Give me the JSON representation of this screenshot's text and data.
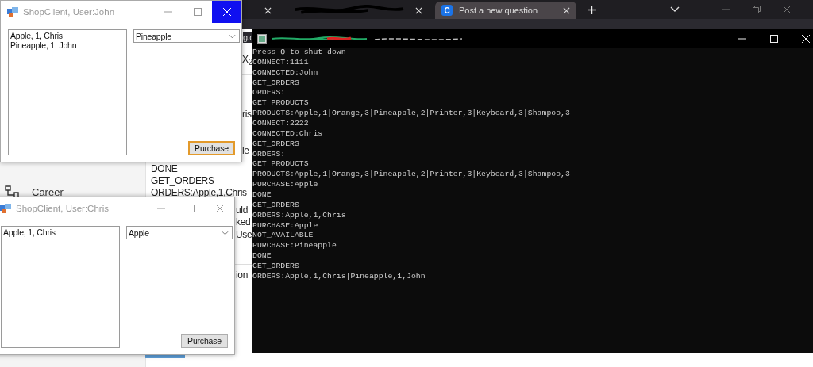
{
  "browser": {
    "tabs": [
      {
        "kind": "clipped",
        "selected": false
      },
      {
        "kind": "redacted",
        "selected": false
      },
      {
        "kind": "titled",
        "favicon_letter": "C",
        "label": "Post a new question",
        "selected": true
      }
    ],
    "address_fragment": "g.c"
  },
  "web_page": {
    "sidebar_item": "Career",
    "fragments": [
      "X$_{2}$",
      "ris",
      "le",
      "DONE",
      "GET_ORDERS",
      "ORDERS:Apple,1,Chris",
      "uld",
      "ked",
      "Use",
      "ion"
    ]
  },
  "console": {
    "lines": [
      "Press Q to shut down",
      "CONNECT:1111",
      "CONNECTED:John",
      "GET_ORDERS",
      "ORDERS:",
      "GET_PRODUCTS",
      "PRODUCTS:Apple,1|Orange,3|Pineapple,2|Printer,3|Keyboard,3|Shampoo,3",
      "CONNECT:2222",
      "CONNECTED:Chris",
      "GET_ORDERS",
      "ORDERS:",
      "GET_PRODUCTS",
      "PRODUCTS:Apple,1|Orange,3|Pineapple,2|Printer,3|Keyboard,3|Shampoo,3",
      "PURCHASE:Apple",
      "DONE",
      "GET_ORDERS",
      "ORDERS:Apple,1,Chris",
      "PURCHASE:Apple",
      "NOT_AVAILABLE",
      "PURCHASE:Pineapple",
      "DONE",
      "GET_ORDERS",
      "ORDERS:Apple,1,Chris|Pineapple,1,John"
    ]
  },
  "shop_windows": [
    {
      "title": "ShopClient, User:John",
      "close_hovered": true,
      "orders": [
        "Apple, 1, Chris",
        "Pineapple, 1, John"
      ],
      "product": "Pineapple",
      "button": "Purchase",
      "button_focused": true
    },
    {
      "title": "ShopClient, User:Chris",
      "close_hovered": false,
      "orders": [
        "Apple, 1, Chris"
      ],
      "product": "Apple",
      "button": "Purchase",
      "button_focused": false
    }
  ]
}
